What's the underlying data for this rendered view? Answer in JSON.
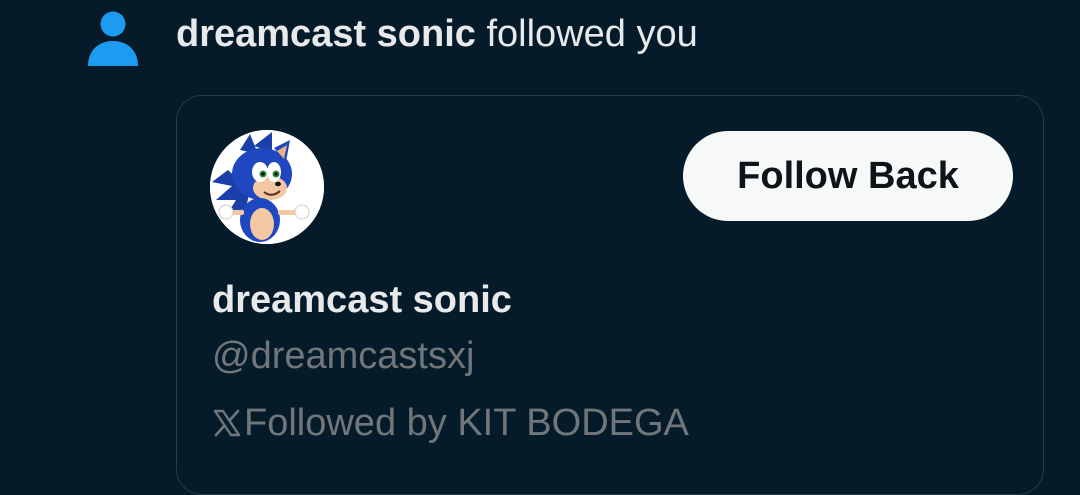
{
  "notification": {
    "actor_name": "dreamcast sonic",
    "action_text": "followed you",
    "icon": "person-icon",
    "icon_color": "#1d9bf0"
  },
  "card": {
    "avatar_alt": "sonic-avatar",
    "follow_button_label": "Follow Back",
    "display_name": "dreamcast sonic",
    "handle": "@dreamcastsxj",
    "followed_by_icon": "x-logo-icon",
    "followed_by_text": "Followed by KIT BODEGA"
  },
  "colors": {
    "background": "#051b2a",
    "primary_text": "#e7e9ea",
    "secondary_text": "#71767b",
    "button_bg": "#f7f9f9",
    "button_text": "#0f1419"
  }
}
